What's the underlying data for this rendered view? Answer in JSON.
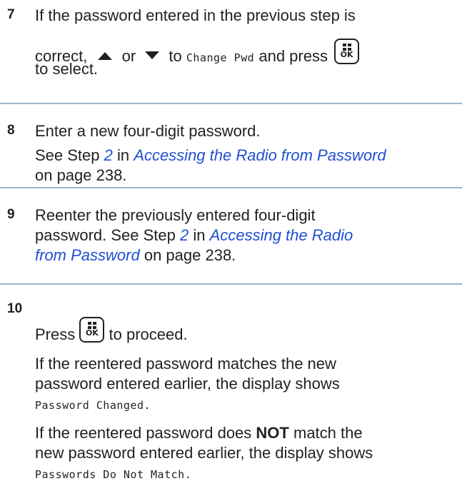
{
  "steps": [
    {
      "number": "7",
      "lines": [
        "If the password entered in the previous step is",
        "correct,",
        "or",
        "to",
        "Change Pwd",
        "and press",
        "to select."
      ]
    },
    {
      "number": "8",
      "text1": "Enter a new four-digit password.",
      "see": "See Step",
      "step_ref": "2",
      "in": "in",
      "link": "Accessing the Radio from Password",
      "page": "on page 238."
    },
    {
      "number": "9",
      "line1": "Reenter the previously entered four-digit",
      "line2a": "password. See Step",
      "step_ref": "2",
      "line2b": "in",
      "link_part1": "Accessing the Radio",
      "link_part2": "from Password",
      "page": "on page 238."
    },
    {
      "number": "10",
      "press": "Press",
      "proceed": "to proceed.",
      "para1_line1": "If the reentered password matches the new",
      "para1_line2": "password entered earlier, the display shows",
      "para1_code": "Password Changed.",
      "para2_line1a": "If the reentered password does",
      "para2_not": "NOT",
      "para2_line1b": "match the",
      "para2_line2": "new password entered earlier, the display shows",
      "para2_code": "Passwords Do Not Match."
    }
  ],
  "ok_key": {
    "label": "OK",
    "icon": "menu-ok-key-icon"
  },
  "arrows": {
    "up": "up-arrow-icon",
    "down": "down-arrow-icon"
  },
  "colors": {
    "text": "#231f20",
    "link": "#1f4fd1",
    "rule": "#9eb3c9"
  }
}
